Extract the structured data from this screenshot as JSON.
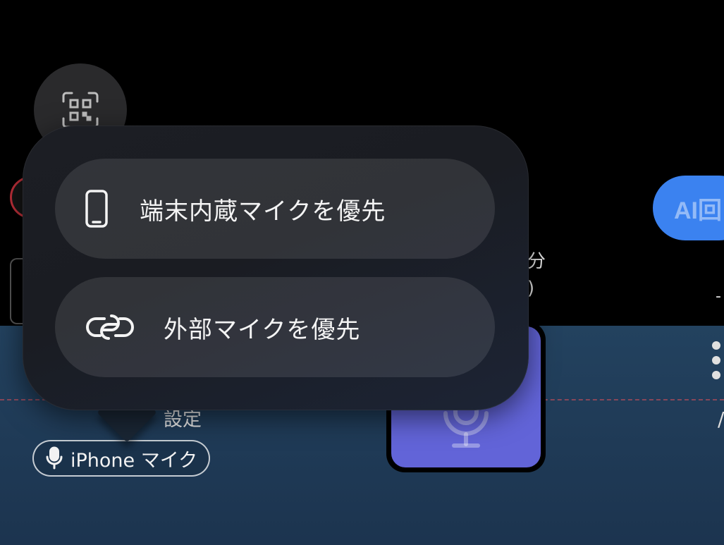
{
  "context_menu": {
    "items": [
      {
        "label": "端末内蔵マイクを優先",
        "icon": "iphone-icon"
      },
      {
        "label": "外部マイクを優先",
        "icon": "link-icon"
      }
    ]
  },
  "toolbar": {
    "ai_button_label": "AI回",
    "qr_icon": "qr-scan-icon"
  },
  "side": {
    "text_line1": "分",
    "text_line2": ")"
  },
  "settings_label": "設定",
  "mic_source": {
    "label": "iPhone マイク",
    "icon": "microphone-icon"
  },
  "colors": {
    "accent_blue": "#3b82f0",
    "mic_tile": "#6264d8",
    "panel": "#23425f",
    "record_red": "#c0303a"
  }
}
